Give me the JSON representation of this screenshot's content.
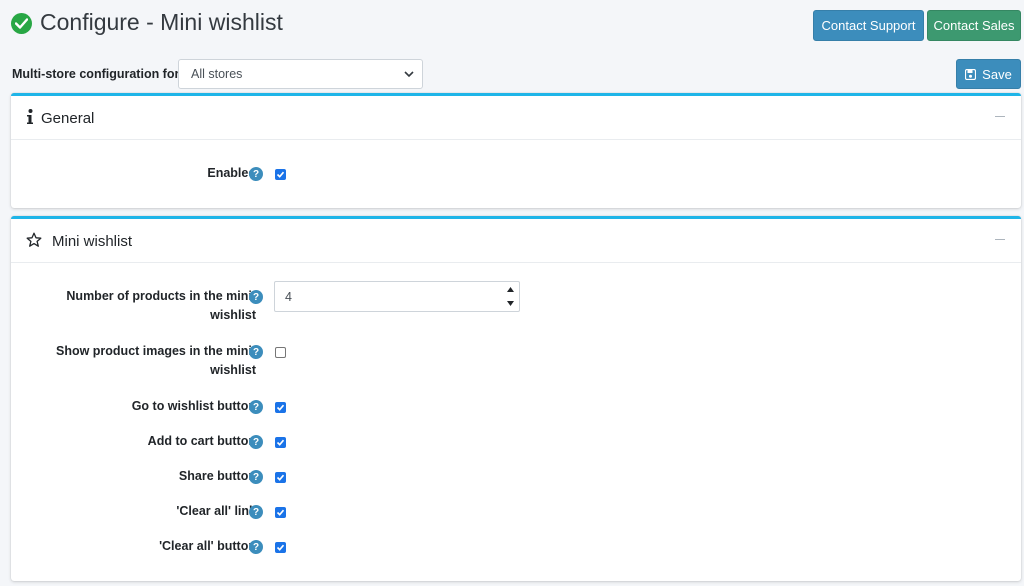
{
  "header": {
    "title": "Configure - Mini wishlist",
    "contact_support": "Contact Support",
    "contact_sales": "Contact Sales"
  },
  "toolbar": {
    "multistore_label": "Multi-store configuration for",
    "store_selected": "All stores",
    "save_label": "Save"
  },
  "general": {
    "title": "General",
    "enabled_label": "Enabled",
    "enabled": true
  },
  "mini": {
    "title": "Mini wishlist",
    "num_products_label_line1": "Number of products in the mini-",
    "num_products_label_line2": "wishlist",
    "num_products_value": "4",
    "show_images_label_line1": "Show product images in the mini-",
    "show_images_label_line2": "wishlist",
    "show_images": false,
    "go_to_wishlist_label": "Go to wishlist button",
    "go_to_wishlist": true,
    "add_to_cart_label": "Add to cart button",
    "add_to_cart": true,
    "share_label": "Share button",
    "share": true,
    "clear_all_link_label": "'Clear all' link",
    "clear_all_link": true,
    "clear_all_button_label": "'Clear all' button",
    "clear_all_button": true
  },
  "icons": {
    "title": "check-circle-icon",
    "general": "info-icon",
    "mini": "star-outline-icon",
    "help": "question-circle-icon",
    "save": "floppy-disk-icon"
  },
  "colors": {
    "primary": "#3c8dbc",
    "success": "#3d9970",
    "card_accent": "#1fb5e8",
    "check": "#28a745"
  }
}
